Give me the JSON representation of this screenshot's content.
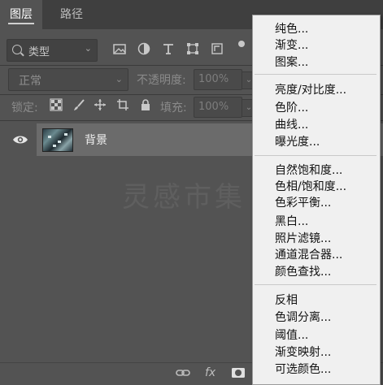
{
  "tabs": [
    {
      "label": "图层"
    },
    {
      "label": "路径"
    }
  ],
  "filter": {
    "kind_label": "类型"
  },
  "blend_mode": {
    "value": "正常"
  },
  "opacity": {
    "label": "不透明度:",
    "value": "100%"
  },
  "lock": {
    "label": "锁定:"
  },
  "fill": {
    "label": "填充:",
    "value": "100%"
  },
  "layer": {
    "name": "背景"
  },
  "watermark": "灵感市集",
  "bottom_icons": {
    "fx": "fx"
  },
  "menu": {
    "groups": [
      [
        "纯色...",
        "渐变...",
        "图案..."
      ],
      [
        "亮度/对比度...",
        "色阶...",
        "曲线...",
        "曝光度..."
      ],
      [
        "自然饱和度...",
        "色相/饱和度...",
        "色彩平衡...",
        "黑白...",
        "照片滤镜...",
        "通道混合器...",
        "颜色查找..."
      ],
      [
        "反相",
        "色调分离...",
        "阈值...",
        "渐变映射...",
        "可选颜色..."
      ]
    ]
  }
}
